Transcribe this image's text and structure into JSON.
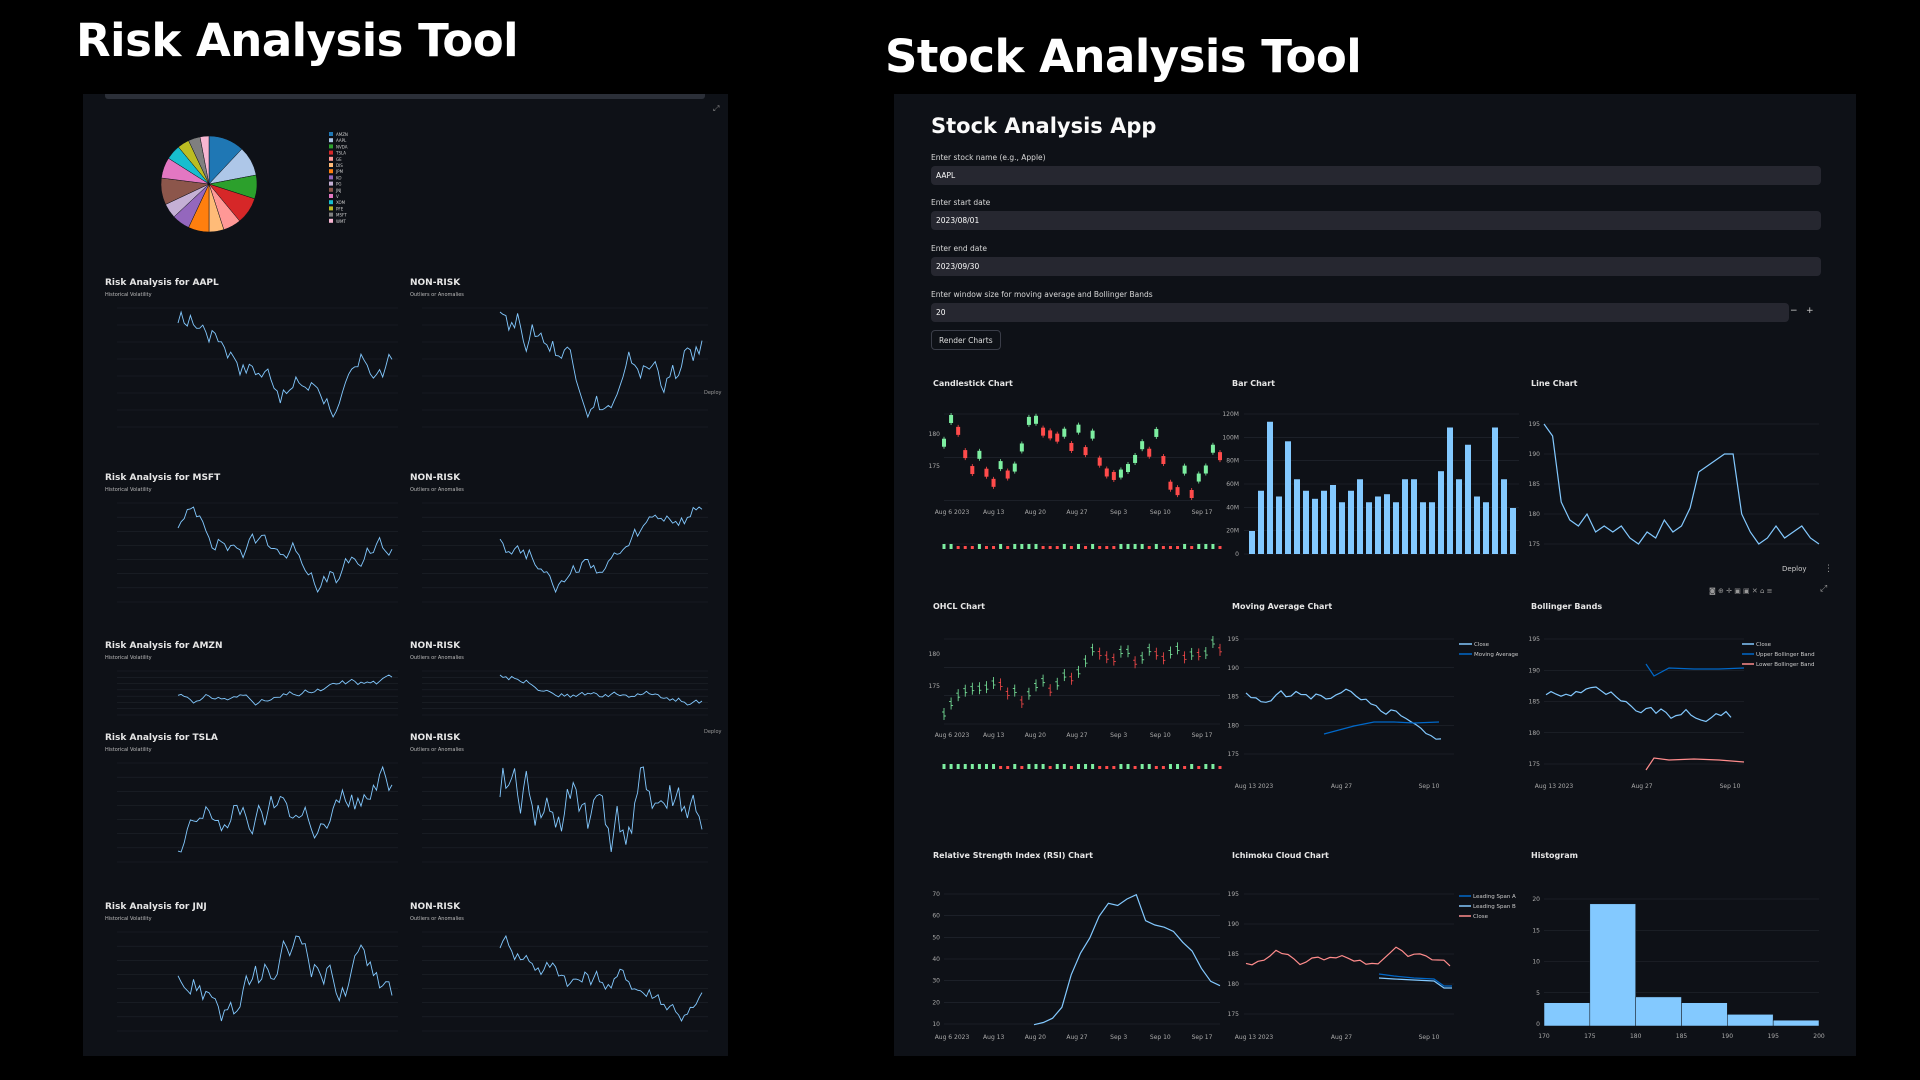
{
  "titles": {
    "left": "Risk Analysis Tool",
    "right": "Stock Analysis Tool"
  },
  "risk": {
    "pie_legend": [
      "AMZN",
      "AAPL",
      "NVDA",
      "TSLA",
      "GE",
      "DIS",
      "JPM",
      "KO",
      "PG",
      "JNJ",
      "V",
      "XOM",
      "PFE",
      "MSFT",
      "WMT"
    ],
    "pie_colors": [
      "#1f77b4",
      "#aec7e8",
      "#2ca02c",
      "#d62728",
      "#ff9896",
      "#ffbb78",
      "#ff7f0e",
      "#9467bd",
      "#c5b0d5",
      "#8c564b",
      "#e377c2",
      "#17becf",
      "#bcbd22",
      "#7f7f7f",
      "#f7b6d2"
    ],
    "sections": [
      {
        "title": "Risk Analysis for AAPL",
        "subtitle": "Historical Volatility",
        "nr_title": "NON-RISK",
        "nr_subtitle": "Outliers or Anomalies"
      },
      {
        "title": "Risk Analysis for MSFT",
        "subtitle": "Historical Volatility",
        "nr_title": "NON-RISK",
        "nr_subtitle": "Outliers or Anomalies"
      },
      {
        "title": "Risk Analysis for AMZN",
        "subtitle": "Historical Volatility",
        "nr_title": "NON-RISK",
        "nr_subtitle": "Outliers or Anomalies"
      },
      {
        "title": "Risk Analysis for TSLA",
        "subtitle": "Historical Volatility",
        "nr_title": "NON-RISK",
        "nr_subtitle": "Outliers or Anomalies"
      },
      {
        "title": "Risk Analysis for JNJ",
        "subtitle": "Historical Volatility",
        "nr_title": "NON-RISK",
        "nr_subtitle": "Outliers or Anomalies"
      }
    ],
    "deploy": "Deploy"
  },
  "app": {
    "title": "Stock Analysis App",
    "fields": [
      {
        "label": "Enter stock name (e.g., Apple)",
        "value": "AAPL"
      },
      {
        "label": "Enter start date",
        "value": "2023/08/01"
      },
      {
        "label": "Enter end date",
        "value": "2023/09/30"
      },
      {
        "label": "Enter window size for moving average and Bollinger Bands",
        "value": "20"
      }
    ],
    "stepper": {
      "minus": "−",
      "plus": "+"
    },
    "render_button": "Render Charts",
    "deploy": "Deploy",
    "charts": {
      "candlestick": "Candlestick Chart",
      "bar": "Bar Chart",
      "line": "Line Chart",
      "ohlc": "OHCL Chart",
      "ma": "Moving Average Chart",
      "bollinger": "Bollinger Bands",
      "rsi": "Relative Strength Index (RSI) Chart",
      "ichimoku": "Ichimoku Cloud Chart",
      "histogram": "Histogram"
    },
    "date_ticks": [
      "Aug 6\n2023",
      "Aug 13",
      "Aug 20",
      "Aug 27",
      "Sep 3",
      "Sep 10",
      "Sep 17"
    ],
    "date_ticks_short": [
      "Aug 13\n2023",
      "Aug 27",
      "Sep 10"
    ],
    "price_ticks": [
      "175",
      "180",
      "185",
      "190",
      "195"
    ],
    "bar_ticks": [
      "0",
      "20M",
      "40M",
      "60M",
      "80M",
      "100M",
      "120M"
    ],
    "rsi_ticks": [
      "10",
      "20",
      "30",
      "40",
      "50",
      "60",
      "70"
    ],
    "hist_xticks": [
      "170",
      "175",
      "180",
      "185",
      "190",
      "195",
      "200"
    ],
    "hist_yticks": [
      "0",
      "5",
      "10",
      "15",
      "20"
    ],
    "ma_legend": [
      "Close",
      "Moving Average"
    ],
    "bb_legend": [
      "Close",
      "Upper Bollinger Band",
      "Lower Bollinger Band"
    ],
    "ichi_legend": [
      "Leading Span A",
      "Leading Span B",
      "Close"
    ],
    "colors": {
      "blue": "#83c9ff",
      "dblue": "#0068c9",
      "red": "#ff8c8c",
      "up": "#7defa1",
      "down": "#ff4b4b",
      "grid": "#262a33"
    }
  },
  "chart_data": [
    {
      "type": "bar",
      "title": "Bar Chart",
      "values": [
        20,
        55,
        115,
        50,
        98,
        65,
        55,
        48,
        55,
        60,
        45,
        55,
        65,
        45,
        50,
        52,
        45,
        65,
        65,
        45,
        45,
        72,
        110,
        65,
        95,
        50,
        45,
        110,
        65,
        40
      ]
    },
    {
      "type": "line",
      "title": "Line Chart",
      "values": [
        195,
        193,
        182,
        179,
        178,
        180,
        177,
        178,
        177,
        178,
        176,
        175,
        177,
        176,
        179,
        177,
        178,
        181,
        187,
        188,
        189,
        190,
        190,
        180,
        177,
        175,
        176,
        178,
        176,
        177,
        178,
        176,
        175
      ]
    },
    {
      "type": "bar",
      "title": "Histogram",
      "categories": [
        "170-175",
        "175-180",
        "180-185",
        "185-190",
        "190-195",
        "195-200"
      ],
      "values": [
        4,
        21,
        5,
        4,
        2,
        1
      ],
      "xlim": [
        170,
        200
      ],
      "ylim": [
        0,
        22
      ]
    },
    {
      "type": "line",
      "title": "Relative Strength Index (RSI) Chart",
      "values": [
        12,
        13,
        15,
        20,
        35,
        45,
        52,
        62,
        68,
        67,
        70,
        72,
        60,
        58,
        57,
        55,
        50,
        46,
        38,
        32,
        30
      ]
    }
  ]
}
